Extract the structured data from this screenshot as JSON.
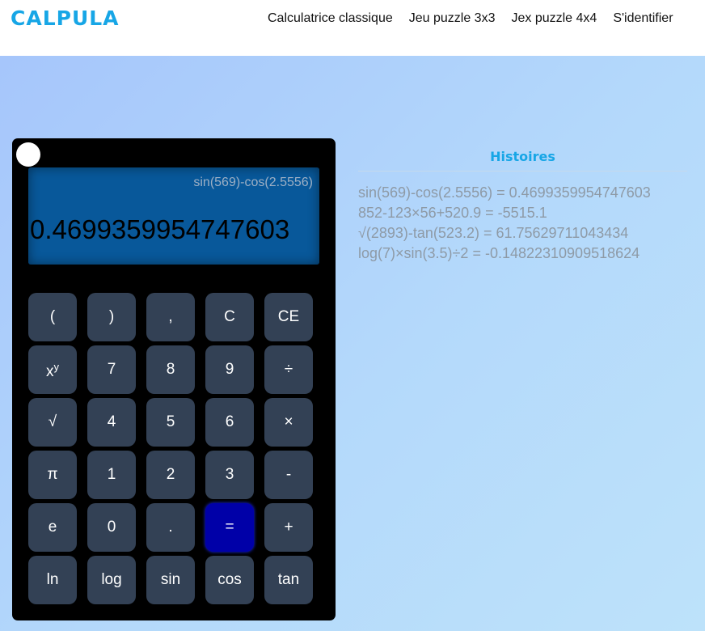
{
  "header": {
    "logo": "CALPULA",
    "nav": [
      "Calculatrice classique",
      "Jeu puzzle 3x3",
      "Jex puzzle 4x4",
      "S'identifier"
    ]
  },
  "calculator": {
    "expression": "sin(569)-cos(2.5556)",
    "result": "0.4699359954747603",
    "keys": [
      "(",
      ")",
      ",",
      "C",
      "CE",
      "xʸ",
      "7",
      "8",
      "9",
      "÷",
      "√",
      "4",
      "5",
      "6",
      "×",
      "π",
      "1",
      "2",
      "3",
      "-",
      "e",
      "0",
      ".",
      "=",
      "+",
      "ln",
      "log",
      "sin",
      "cos",
      "tan"
    ],
    "power_key": {
      "base": "x",
      "exp": "y"
    }
  },
  "history": {
    "title": "Histoires",
    "items": [
      "sin(569)-cos(2.5556) = 0.4699359954747603",
      "852-123×56+520.9 = -5515.1",
      "√(2893)-tan(523.2) = 61.75629711043434",
      "log(7)×sin(3.5)÷2 = -0.14822310909518624"
    ]
  },
  "colors": {
    "accent": "#17a6e6",
    "key": "#334155",
    "equals_key": "#0000a8",
    "screen": "#08589a"
  }
}
